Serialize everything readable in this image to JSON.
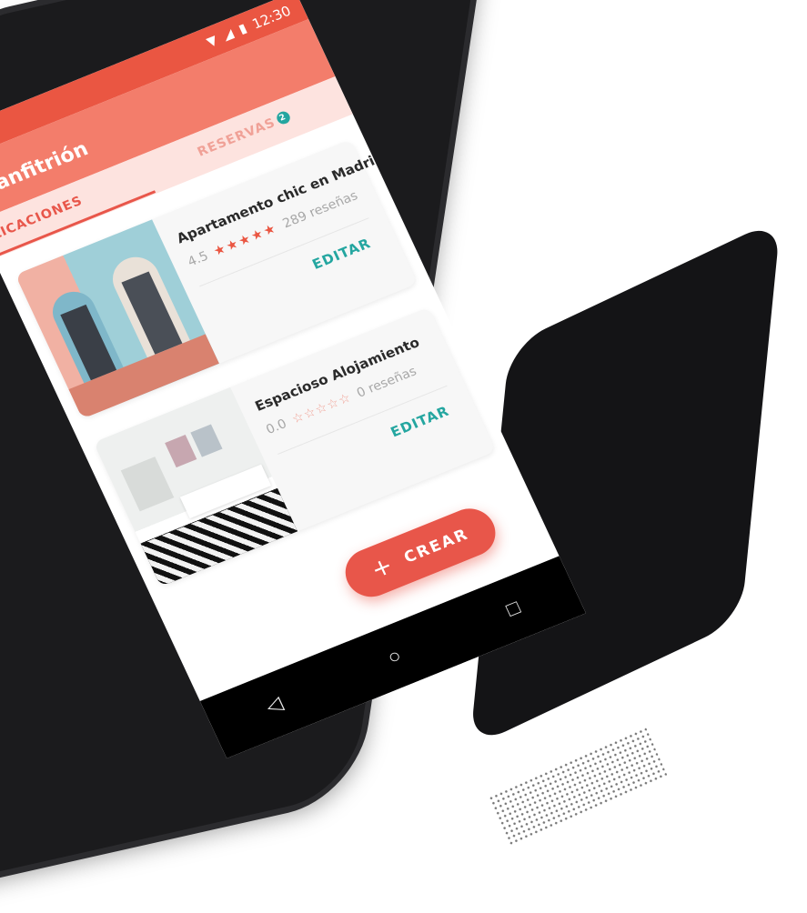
{
  "status_bar": {
    "time": "12:30",
    "icons": [
      "wifi-icon",
      "signal-icon",
      "battery-icon"
    ]
  },
  "app_bar": {
    "title": "r anfitrión"
  },
  "tabs": [
    {
      "label": "LICACIONES",
      "active": true
    },
    {
      "label": "RESERVAS",
      "active": false,
      "badge": "2"
    }
  ],
  "listings": [
    {
      "title": "Apartamento chic en Madrid",
      "rating": "4.5",
      "stars_filled": "★★★★★",
      "reviews": "289 reseñas",
      "action": "EDITAR",
      "image": "building-facade"
    },
    {
      "title": "Espacioso Alojamiento",
      "rating": "0.0",
      "stars_empty": "☆☆☆☆☆",
      "reviews": "0 reseñas",
      "action": "EDITAR",
      "image": "bedroom-interior"
    }
  ],
  "fab": {
    "icon": "plus-icon",
    "label": "CREAR"
  },
  "nav": [
    "back-icon",
    "home-icon",
    "recents-icon"
  ],
  "colors": {
    "primary": "#ea5642",
    "app_bar": "#f37d6b",
    "tab_bar": "#fde3df",
    "accent": "#24a6a0"
  }
}
